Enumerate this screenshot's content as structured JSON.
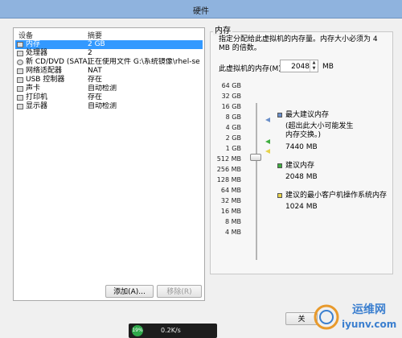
{
  "window": {
    "title": "硬件"
  },
  "device_list": {
    "col_device": "设备",
    "col_summary": "摘要",
    "rows": [
      {
        "name": "内存",
        "summary": "2 GB",
        "icon": "memory-icon"
      },
      {
        "name": "处理器",
        "summary": "2",
        "icon": "cpu-icon"
      },
      {
        "name": "新 CD/DVD (SATA)",
        "summary": "正在使用文件 G:\\系统镜像\\rhel-serv...",
        "icon": "cdrom-icon"
      },
      {
        "name": "网络适配器",
        "summary": "NAT",
        "icon": "network-icon"
      },
      {
        "name": "USB 控制器",
        "summary": "存在",
        "icon": "usb-icon"
      },
      {
        "name": "声卡",
        "summary": "自动检测",
        "icon": "sound-icon"
      },
      {
        "name": "打印机",
        "summary": "存在",
        "icon": "printer-icon"
      },
      {
        "name": "显示器",
        "summary": "自动检测",
        "icon": "display-icon"
      }
    ],
    "add_button": "添加(A)...",
    "remove_button": "移除(R)"
  },
  "memory": {
    "group_label": "内存",
    "description": "指定分配给此虚拟机的内存量。内存大小必须为 4 MB 的倍数。",
    "field_label": "此虚拟机的内存(M):",
    "value": "2048",
    "unit": "MB",
    "scale_labels": [
      "64 GB",
      "32 GB",
      "16 GB",
      "8 GB",
      "4 GB",
      "2 GB",
      "1 GB",
      "512 MB",
      "256 MB",
      "128 MB",
      "64 MB",
      "32 MB",
      "16 MB",
      "8 MB",
      "4 MB"
    ],
    "max_recommended_label": "最大建议内存",
    "max_recommended_note": "(超出此大小可能发生内存交换。)",
    "max_recommended_value": "7440 MB",
    "recommended_label": "建议内存",
    "recommended_value": "2048 MB",
    "guest_min_label": "建议的最小客户机操作系统内存",
    "guest_min_value": "1024 MB",
    "colors": {
      "max": "#6a8fc9",
      "recommended": "#3fae3f",
      "guest_min": "#e6d24a"
    }
  },
  "dialog": {
    "ok": "关",
    "cancel": ""
  },
  "taskbar": {
    "percent": "19%",
    "speed": "0.2K/s"
  },
  "watermark": {
    "text": "运维网",
    "url": "iyunv.com"
  }
}
